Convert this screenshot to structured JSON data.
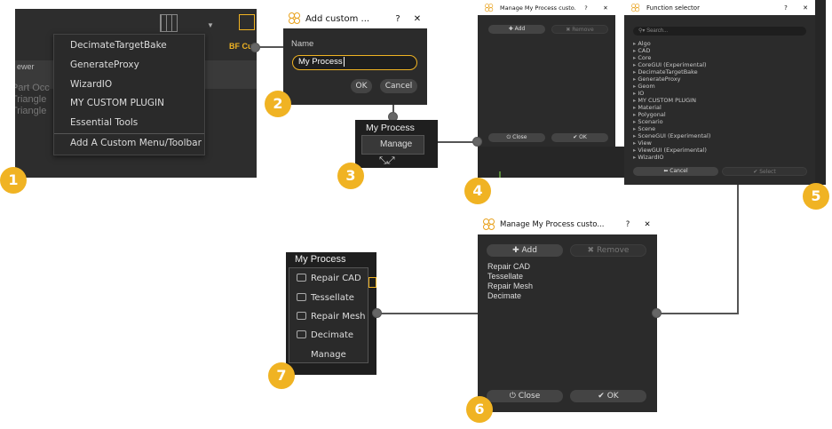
{
  "colors": {
    "accent": "#f0b323",
    "panel": "#2b2b2b",
    "connector": "#555555"
  },
  "panel1": {
    "toolbar_label": "BF Cul",
    "viewer_tab": "ewer",
    "bg_text": [
      "Part Occ",
      "Triangle",
      "Triangle"
    ],
    "menu_items": [
      "DecimateTargetBake",
      "GenerateProxy",
      "WizardIO",
      "MY CUSTOM PLUGIN",
      "Essential Tools"
    ],
    "menu_last": "Add A Custom Menu/Toolbar"
  },
  "panel2": {
    "title": "Add custom ...",
    "help": "?",
    "close": "✕",
    "name_label": "Name",
    "name_value": "My Process",
    "ok": "OK",
    "cancel": "Cancel"
  },
  "panel3": {
    "menu_title": "My Process",
    "manage": "Manage"
  },
  "panel4": {
    "title": "Manage My Process custo...",
    "help": "?",
    "close_x": "✕",
    "add": "Add",
    "remove": "Remove",
    "close_btn": "Close",
    "ok": "OK"
  },
  "panel5": {
    "title": "Function selector",
    "help": "?",
    "close_x": "✕",
    "search_placeholder": "Search...",
    "items": [
      "Algo",
      "CAD",
      "Core",
      "CoreGUI (Experimental)",
      "DecimateTargetBake",
      "GenerateProxy",
      "Geom",
      "IO",
      "MY CUSTOM PLUGIN",
      "Material",
      "Polygonal",
      "Scenario",
      "Scene",
      "SceneGUI (Experimental)",
      "View",
      "ViewGUI (Experimental)",
      "WizardIO"
    ],
    "cancel": "Cancel",
    "select": "Select"
  },
  "panel6": {
    "title": "Manage My Process custo...",
    "help": "?",
    "close_x": "✕",
    "add": "Add",
    "remove": "Remove",
    "items": [
      "Repair CAD",
      "Tessellate",
      "Repair Mesh",
      "Decimate"
    ],
    "close_btn": "Close",
    "ok": "OK"
  },
  "panel7": {
    "menu_title": "My Process",
    "items": [
      "Repair CAD",
      "Tessellate",
      "Repair Mesh",
      "Decimate"
    ],
    "manage": "Manage"
  },
  "badges": [
    "1",
    "2",
    "3",
    "4",
    "5",
    "6",
    "7"
  ]
}
